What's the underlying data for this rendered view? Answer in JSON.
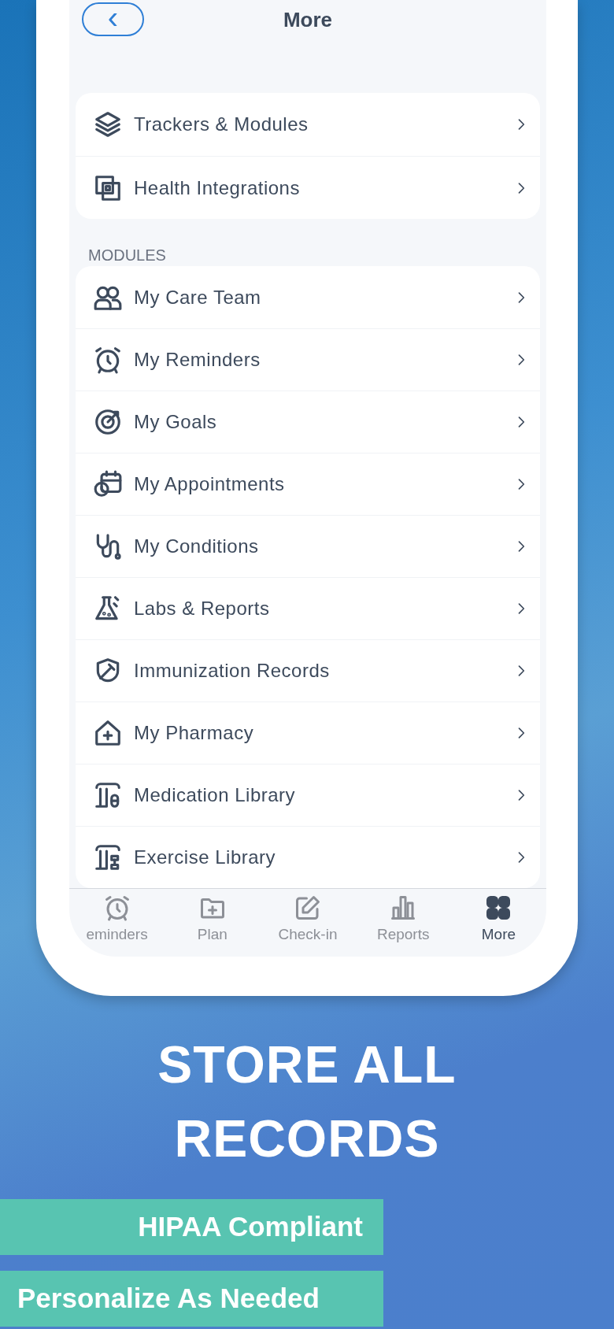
{
  "header": {
    "back": "‹",
    "title": "More"
  },
  "top_items": [
    {
      "label": "Trackers & Modules"
    },
    {
      "label": "Health Integrations"
    }
  ],
  "section_label": "MODULES",
  "modules": [
    {
      "label": "My Care Team"
    },
    {
      "label": "My Reminders"
    },
    {
      "label": "My Goals"
    },
    {
      "label": "My Appointments"
    },
    {
      "label": "My Conditions"
    },
    {
      "label": "Labs & Reports"
    },
    {
      "label": "Immunization Records"
    },
    {
      "label": "My Pharmacy"
    },
    {
      "label": "Medication Library"
    },
    {
      "label": "Exercise Library"
    }
  ],
  "tab_bar": [
    {
      "label": "eminders",
      "selected": false
    },
    {
      "label": "Plan",
      "selected": false
    },
    {
      "label": "Check-in",
      "selected": false
    },
    {
      "label": "Reports",
      "selected": false
    },
    {
      "label": "More",
      "selected": true
    }
  ],
  "headline": [
    "STORE ALL",
    "RECORDS"
  ],
  "badges": [
    {
      "text": "HIPAA Compliant"
    },
    {
      "text": "Personalize As Needed"
    }
  ]
}
